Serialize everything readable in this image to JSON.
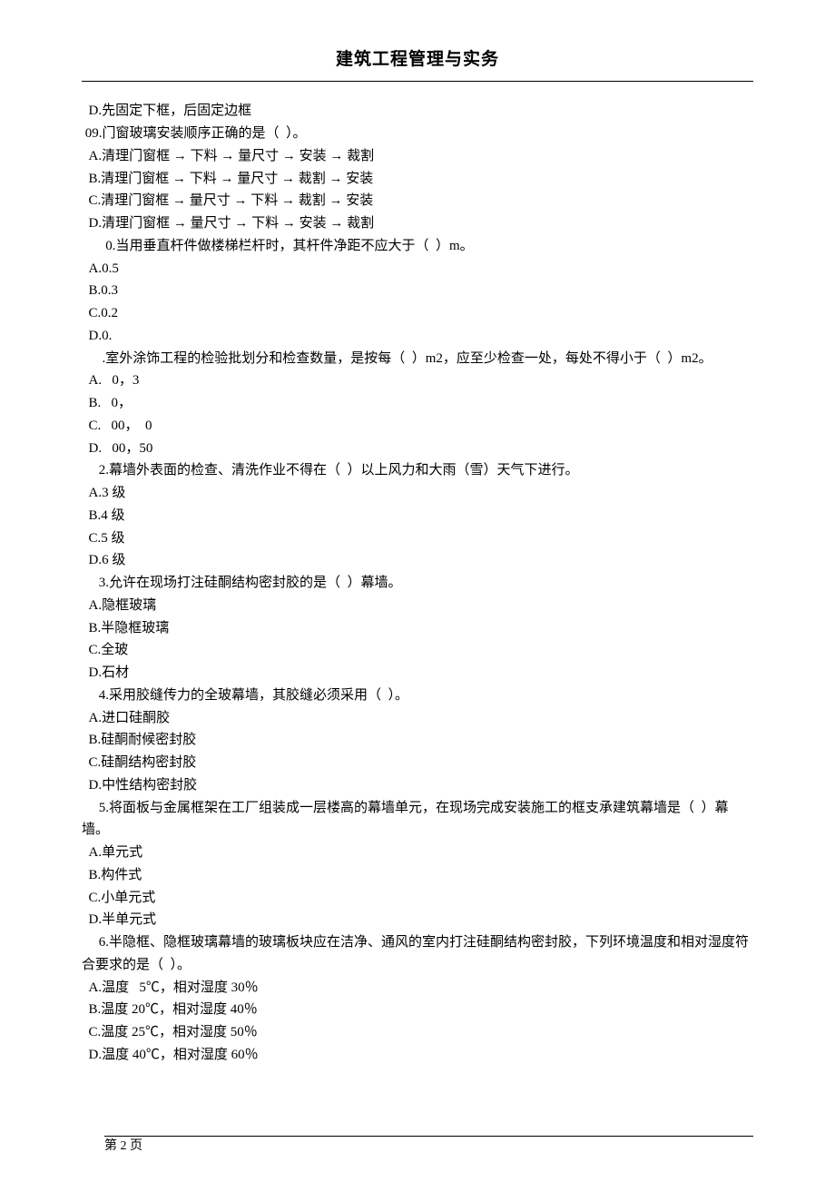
{
  "header": {
    "title": "建筑工程管理与实务"
  },
  "lines": [
    "  D.先固定下框，后固定边框",
    " 09.门窗玻璃安装顺序正确的是（  ）。",
    "  A.清理门窗框 → 下料 → 量尺寸 → 安装 → 裁割",
    "  B.清理门窗框 → 下料 → 量尺寸 → 裁割 → 安装",
    "  C.清理门窗框 → 量尺寸 → 下料 → 裁割 → 安装",
    "  D.清理门窗框 → 量尺寸 → 下料 → 安装 → 裁割",
    "       0.当用垂直杆件做楼梯栏杆时，其杆件净距不应大于（  ）m。",
    "  A.0.5",
    "  B.0.3",
    "  C.0.2",
    "  D.0.",
    "      .室外涂饰工程的检验批划分和检查数量，是按每（  ）m2，应至少检查一处，每处不得小于（  ）m2。",
    "  A.   0，3",
    "  B.   0，",
    "  C.   00，  0",
    "  D.   00，50",
    "     2.幕墙外表面的检查、清洗作业不得在（  ）以上风力和大雨（雪）天气下进行。",
    "  A.3 级",
    "  B.4 级",
    "  C.5 级",
    "  D.6 级",
    "     3.允许在现场打注硅酮结构密封胶的是（  ）幕墙。",
    "  A.隐框玻璃",
    "  B.半隐框玻璃",
    "  C.全玻",
    "  D.石材",
    "     4.采用胶缝传力的全玻幕墙，其胶缝必须采用（  ）。",
    "  A.进口硅酮胶",
    "  B.硅酮耐候密封胶",
    "  C.硅酮结构密封胶",
    "  D.中性结构密封胶",
    "     5.将面板与金属框架在工厂组装成一层楼高的幕墙单元，在现场完成安装施工的框支承建筑幕墙是（  ）幕墙。",
    "  A.单元式",
    "  B.构件式",
    "  C.小单元式",
    "  D.半单元式",
    "     6.半隐框、隐框玻璃幕墙的玻璃板块应在洁净、通风的室内打注硅酮结构密封胶，下列环境温度和相对湿度符合要求的是（  ）。",
    "  A.温度   5℃，相对湿度 30％",
    "  B.温度 20℃，相对湿度 40％",
    "  C.温度 25℃，相对湿度 50％",
    "  D.温度 40℃，相对湿度 60％"
  ],
  "footer": {
    "page_label": "第 2 页"
  }
}
